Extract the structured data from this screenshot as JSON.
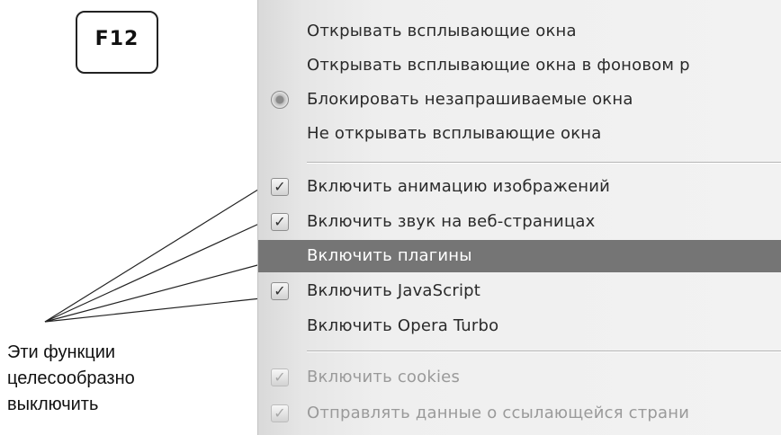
{
  "key": {
    "label": "F12"
  },
  "note": {
    "lines": [
      "Эти функции",
      "целесообразно",
      "выключить"
    ]
  },
  "menu": {
    "popups": [
      {
        "label": "Открывать всплывающие окна",
        "selected": false
      },
      {
        "label": "Открывать всплывающие окна в фоновом р",
        "selected": false
      },
      {
        "label": "Блокировать незапрашиваемые окна",
        "selected": true
      },
      {
        "label": "Не открывать всплывающие окна",
        "selected": false
      }
    ],
    "features": [
      {
        "label": "Включить анимацию изображений",
        "checked": true
      },
      {
        "label": "Включить звук на веб-страницах",
        "checked": true
      },
      {
        "label": "Включить плагины",
        "checked": false,
        "highlighted": true
      },
      {
        "label": "Включить JavaScript",
        "checked": true
      },
      {
        "label": "Включить Opera Turbo",
        "checked": false
      }
    ],
    "privacy": [
      {
        "label": "Включить cookies",
        "checked": true,
        "disabled": true
      },
      {
        "label": "Отправлять данные о ссылающейся страни",
        "checked": true,
        "disabled": true
      }
    ]
  }
}
